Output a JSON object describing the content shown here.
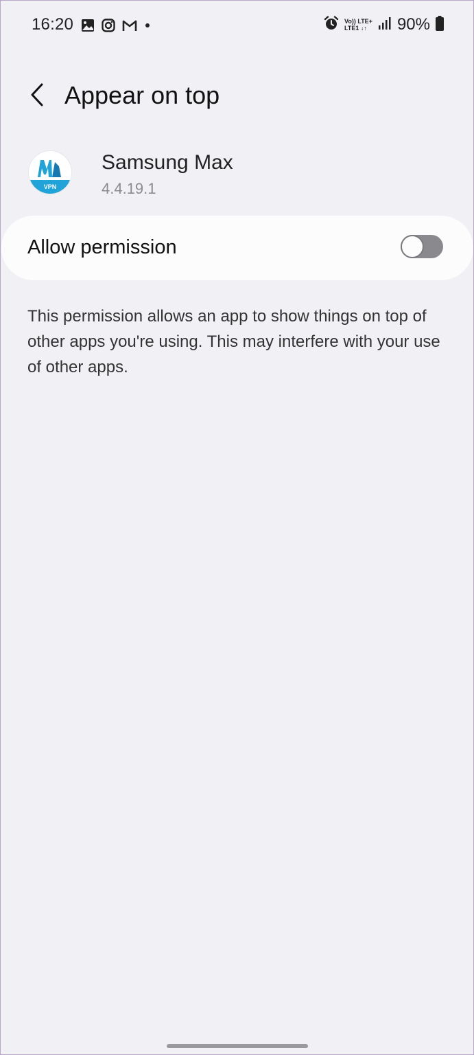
{
  "status_bar": {
    "time": "16:20",
    "left_icons": [
      "gallery-icon",
      "instagram-icon",
      "gmail-icon",
      "dot-icon"
    ],
    "network_line1": "Vo)) LTE+",
    "network_line2": "LTE1 ↓↑",
    "battery": "90%"
  },
  "header": {
    "title": "Appear on top"
  },
  "app": {
    "name": "Samsung Max",
    "version": "4.4.19.1",
    "icon_label": "VPN",
    "icon_color": "#1fa3d9"
  },
  "permission": {
    "label": "Allow permission",
    "enabled": false
  },
  "description": "This permission allows an app to show things on top of other apps you're using. This may interfere with your use of other apps."
}
